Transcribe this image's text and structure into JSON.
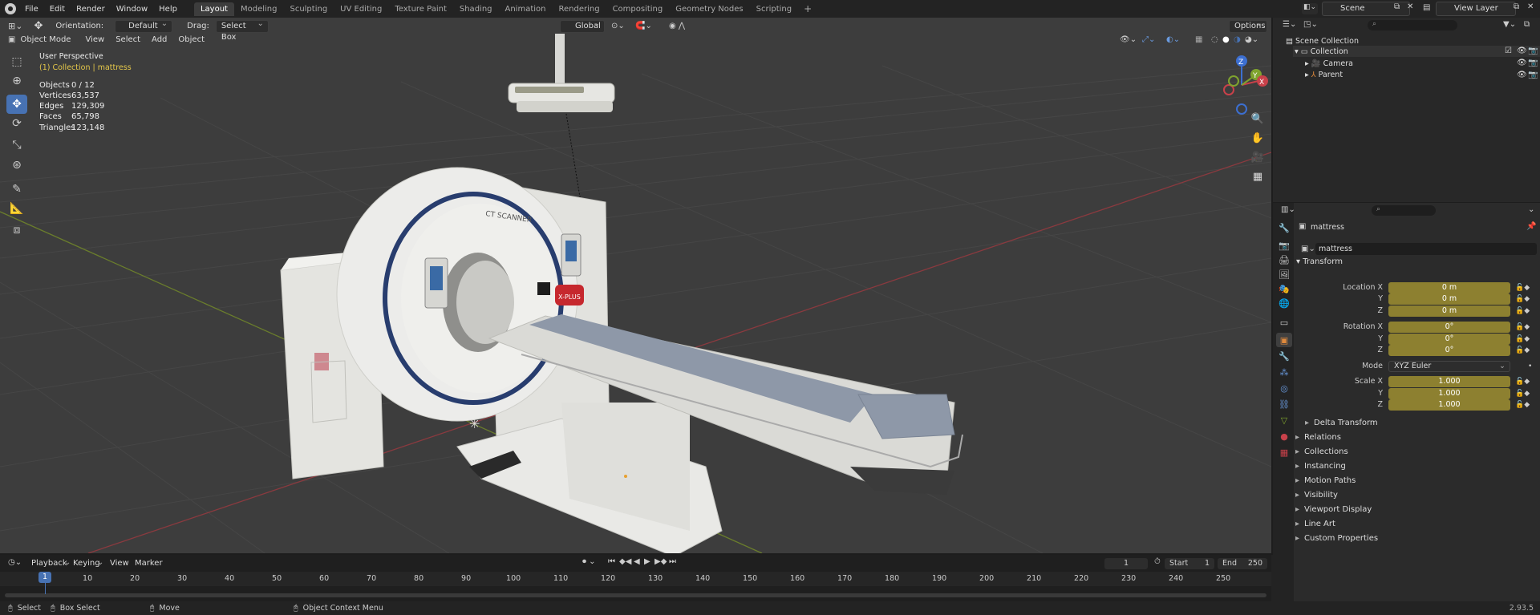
{
  "menu": [
    "File",
    "Edit",
    "Render",
    "Window",
    "Help"
  ],
  "workspaces": [
    {
      "label": "Layout",
      "active": true
    },
    {
      "label": "Modeling"
    },
    {
      "label": "Sculpting"
    },
    {
      "label": "UV Editing"
    },
    {
      "label": "Texture Paint"
    },
    {
      "label": "Shading"
    },
    {
      "label": "Animation"
    },
    {
      "label": "Rendering"
    },
    {
      "label": "Compositing"
    },
    {
      "label": "Geometry Nodes"
    },
    {
      "label": "Scripting"
    }
  ],
  "scene": {
    "name": "Scene",
    "view_layer": "View Layer"
  },
  "tool_header": {
    "orientation_label": "Orientation:",
    "orientation_value": "Default",
    "drag_label": "Drag:",
    "drag_value": "Select Box",
    "transform_space": "Global",
    "options": "Options"
  },
  "viewport_header": {
    "mode": "Object Mode",
    "menus": [
      "View",
      "Select",
      "Add",
      "Object"
    ]
  },
  "viewport": {
    "perspective": "User Perspective",
    "collection_info": "(1) Collection | mattress",
    "stats": [
      {
        "label": "Objects",
        "value": "0 / 12"
      },
      {
        "label": "Vertices",
        "value": "63,537"
      },
      {
        "label": "Edges",
        "value": "129,309"
      },
      {
        "label": "Faces",
        "value": "65,798"
      },
      {
        "label": "Triangles",
        "value": "123,148"
      }
    ],
    "model_text": {
      "brand": "CT SCANNER",
      "logo": "X-PLUS"
    },
    "gizmo_axes": {
      "z": "Z",
      "y": "Y",
      "x": "X"
    }
  },
  "outliner": {
    "root": "Scene Collection",
    "collection": "Collection",
    "items": [
      "Camera",
      "Parent"
    ]
  },
  "properties": {
    "object_name": "mattress",
    "data_name": "mattress",
    "panel": "Transform",
    "location": {
      "label": "Location X",
      "x": "0 m",
      "y": "0 m",
      "z": "0 m"
    },
    "rotation": {
      "label": "Rotation X",
      "x": "0°",
      "y": "0°",
      "z": "0°"
    },
    "mode": {
      "label": "Mode",
      "value": "XYZ Euler"
    },
    "scale": {
      "label": "Scale X",
      "x": "1.000",
      "y": "1.000",
      "z": "1.000"
    },
    "axis_y": "Y",
    "axis_z": "Z",
    "delta": "Delta Transform",
    "sections": [
      "Relations",
      "Collections",
      "Instancing",
      "Motion Paths",
      "Visibility",
      "Viewport Display",
      "Line Art",
      "Custom Properties"
    ]
  },
  "timeline": {
    "menus": [
      "Playback",
      "Keying",
      "View",
      "Marker"
    ],
    "current_frame": "1",
    "start_label": "Start",
    "start": "1",
    "end_label": "End",
    "end": "250",
    "ruler": [
      "10",
      "20",
      "30",
      "40",
      "50",
      "60",
      "70",
      "80",
      "90",
      "100",
      "110",
      "120",
      "130",
      "140",
      "150",
      "160",
      "170",
      "180",
      "190",
      "200",
      "210",
      "220",
      "230",
      "240",
      "250"
    ],
    "cursor": "1"
  },
  "statusbar": {
    "select": "Select",
    "box_select": "Box Select",
    "move": "Move",
    "context": "Object Context Menu",
    "version": "2.93.5"
  },
  "colors": {
    "accent": "#4772b3",
    "field": "#8d8030",
    "viewport_bg": "#3d3d3d",
    "x_axis": "#c8414a",
    "y_axis": "#7fa32e",
    "z_axis": "#3c6fd1"
  }
}
